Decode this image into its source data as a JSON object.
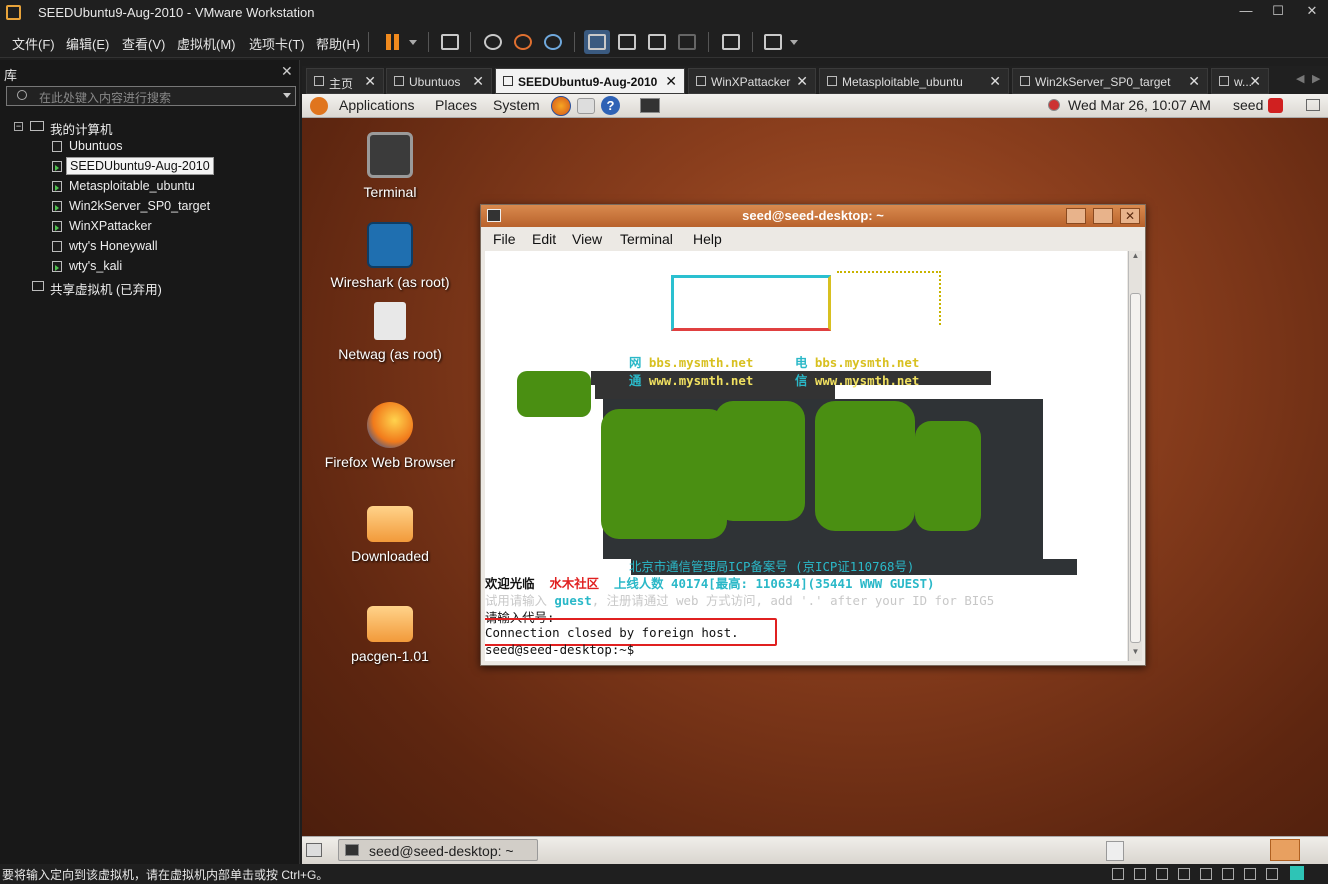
{
  "window": {
    "title": "SEEDUbuntu9-Aug-2010 - VMware Workstation"
  },
  "menu": [
    "文件(F)",
    "编辑(E)",
    "查看(V)",
    "虚拟机(M)",
    "选项卡(T)",
    "帮助(H)"
  ],
  "library": {
    "header": "库",
    "search_placeholder": "在此处键入内容进行搜索",
    "root": "我的计算机",
    "items": [
      "Ubuntuos",
      "SEEDUbuntu9-Aug-2010",
      "Metasploitable_ubuntu",
      "Win2kServer_SP0_target",
      "WinXPattacker",
      "wty's Honeywall",
      "wty's_kali"
    ],
    "shared": "共享虚拟机 (已弃用)"
  },
  "tabs": [
    {
      "label": "主页"
    },
    {
      "label": "Ubuntuos"
    },
    {
      "label": "SEEDUbuntu9-Aug-2010"
    },
    {
      "label": "WinXPattacker"
    },
    {
      "label": "Metasploitable_ubuntu"
    },
    {
      "label": "Win2kServer_SP0_target"
    },
    {
      "label": "w..."
    }
  ],
  "guest_panel": {
    "applications": "Applications",
    "places": "Places",
    "system": "System",
    "clock": "Wed Mar 26, 10:07 AM",
    "user": "seed"
  },
  "desktop_icons": [
    "Terminal",
    "Wireshark (as root)",
    "Netwag (as root)",
    "Firefox Web Browser",
    "Downloaded",
    "pacgen-1.01"
  ],
  "terminal": {
    "title": "seed@seed-desktop: ~",
    "menu": [
      "File",
      "Edit",
      "View",
      "Terminal",
      "Help"
    ],
    "lines": {
      "net1_label": "网",
      "net1_url": "bbs.mysmth.net",
      "tel1_label": "电",
      "tel1_url": "bbs.mysmth.net",
      "net2_label": "通",
      "net2_url": "www.mysmth.net",
      "tel2_label": "信",
      "tel2_url": "www.mysmth.net",
      "icp": "北京市通信管理局ICP备案号 (京ICP证110768号)",
      "welcome": "欢迎光临",
      "community": "水木社区",
      "online": "上线人数 40174[最高: 110634](35441 WWW GUEST)",
      "guest_hint_a": "试用请输入",
      "guest_word": "guest",
      "guest_hint_b": ", 注册请通过 web 方式访问, add '.' after your ID for BIG5",
      "prompt_code": "请输入代号:",
      "closed": "Connection closed by foreign host.",
      "shell": "seed@seed-desktop:~$"
    }
  },
  "taskbar": {
    "item": "seed@seed-desktop: ~"
  },
  "statusbar": {
    "text": "要将输入定向到该虚拟机，请在虚拟机内部单击或按 Ctrl+G。"
  },
  "colors": {
    "accent": "#e8a33a",
    "ubuntu_brown": "#8a3e1d",
    "term_green": "#4a8f12",
    "term_cyan": "#2ab8c8",
    "term_yellow": "#d8c020",
    "highlight_red": "#e02020"
  }
}
